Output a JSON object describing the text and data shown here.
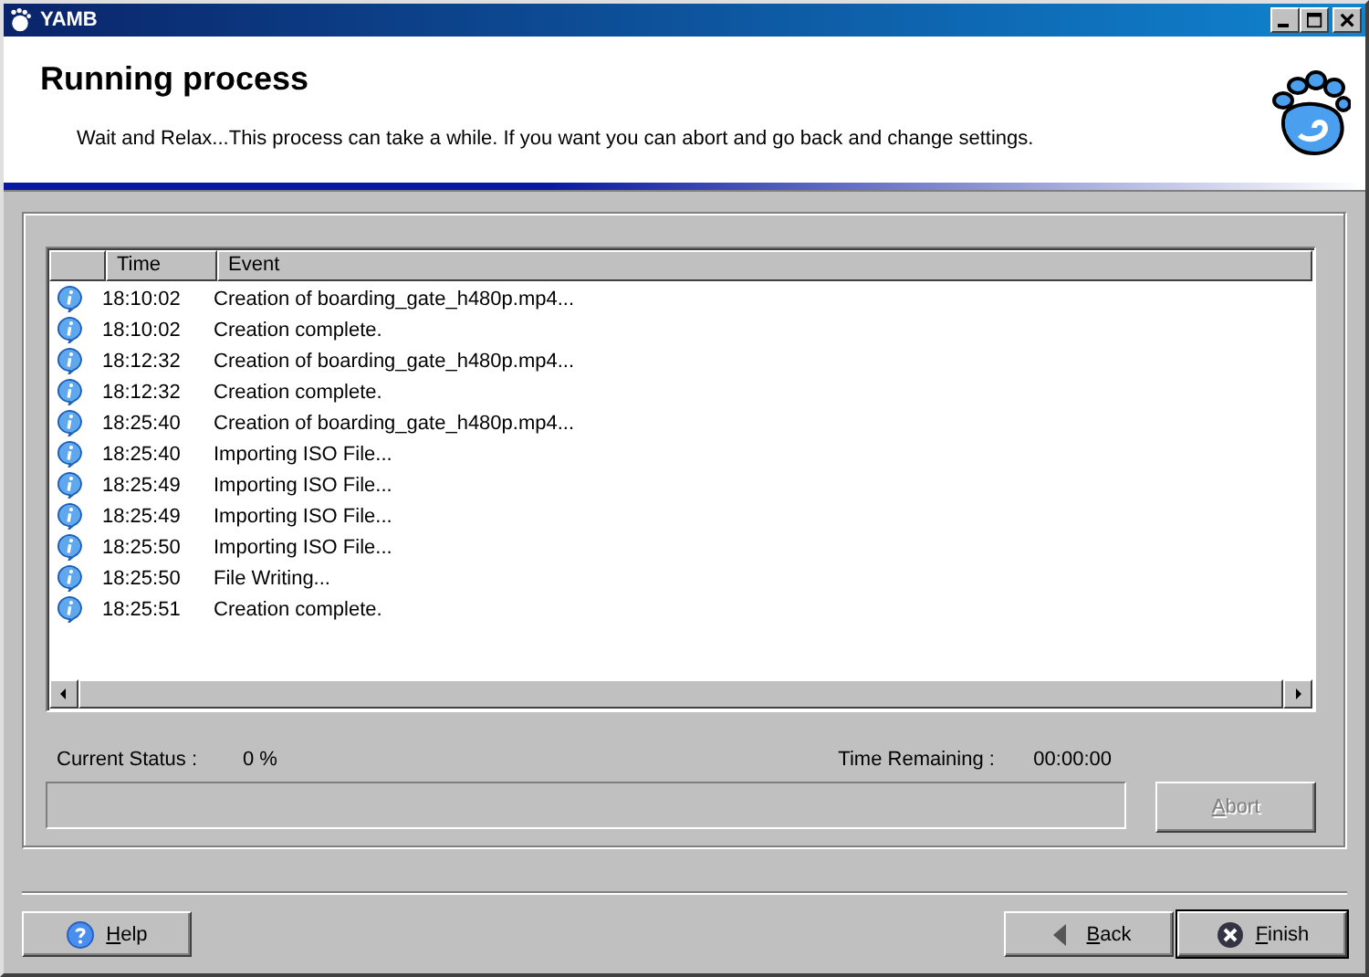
{
  "window": {
    "title": "YAMB"
  },
  "header": {
    "title": "Running process",
    "subtitle": "Wait and Relax...This process can take a while. If you want you can abort and go back and change settings."
  },
  "log": {
    "columns": [
      "Time",
      "Event"
    ],
    "rows": [
      {
        "time": "18:10:02",
        "event": "Creation of boarding_gate_h480p.mp4..."
      },
      {
        "time": "18:10:02",
        "event": "Creation complete."
      },
      {
        "time": "18:12:32",
        "event": "Creation of boarding_gate_h480p.mp4..."
      },
      {
        "time": "18:12:32",
        "event": "Creation complete."
      },
      {
        "time": "18:25:40",
        "event": "Creation of boarding_gate_h480p.mp4..."
      },
      {
        "time": "18:25:40",
        "event": "Importing ISO File..."
      },
      {
        "time": "18:25:49",
        "event": "Importing ISO File..."
      },
      {
        "time": "18:25:49",
        "event": "Importing ISO File..."
      },
      {
        "time": "18:25:50",
        "event": "Importing ISO File..."
      },
      {
        "time": "18:25:50",
        "event": "File Writing..."
      },
      {
        "time": "18:25:51",
        "event": "Creation complete."
      }
    ]
  },
  "status": {
    "label": "Current Status :",
    "value": "0 %",
    "remaining_label": "Time Remaining :",
    "remaining": "00:00:00",
    "progress": {
      "level": 0
    }
  },
  "abort_button": {
    "label": "Abort",
    "disabled": true
  },
  "buttons": [
    {
      "kind": "help",
      "label": "Help",
      "default": false
    },
    {
      "kind": "back",
      "label": "Back",
      "default": false
    },
    {
      "kind": "finish",
      "label": "Finish",
      "default": true
    }
  ]
}
